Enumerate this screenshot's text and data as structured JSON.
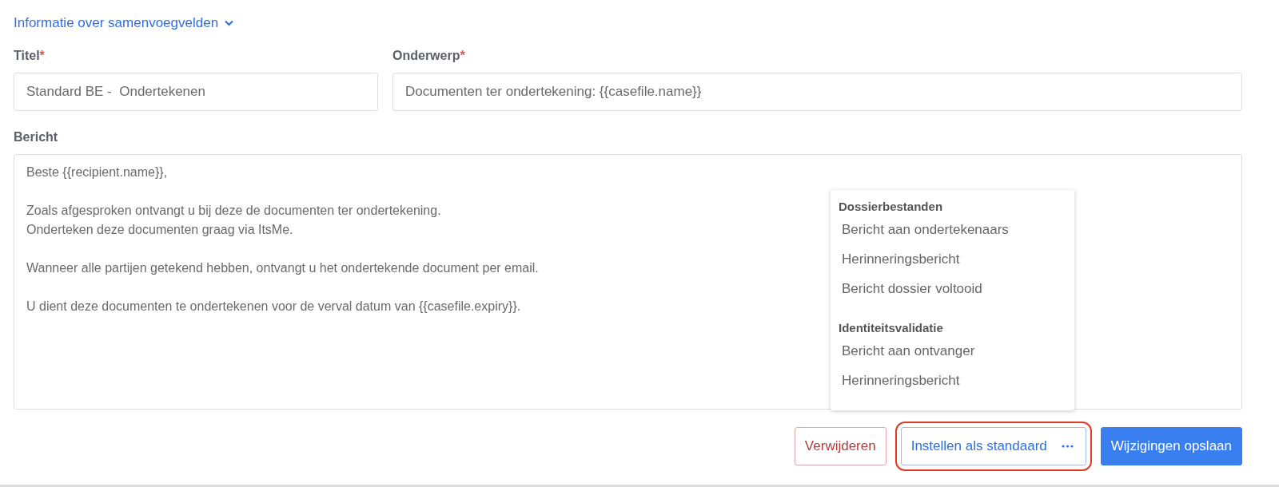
{
  "info_link": {
    "label": "Informatie over samenvoegvelden",
    "expanded": false
  },
  "fields": [
    {
      "label": "Titel",
      "required_mark": "*",
      "value": "Standard BE -  Ondertekenen"
    },
    {
      "label": "Onderwerp",
      "required_mark": "*",
      "value": "Documenten ter ondertekening: {{casefile.name}}"
    }
  ],
  "message": {
    "label": "Bericht",
    "paragraphs": [
      [
        "Beste {{recipient.name}},"
      ],
      [
        "Zoals afgesproken ontvangt u bij deze de documenten ter ondertekening.",
        "Onderteken deze documenten graag via ItsMe."
      ],
      [
        "Wanneer alle partijen getekend hebben, ontvangt u het ondertekende document per email."
      ],
      [
        "U dient deze documenten te ondertekenen voor de verval datum van {{casefile.expiry}}."
      ]
    ]
  },
  "menu": {
    "open": true,
    "groups": [
      {
        "heading": "Dossierbestanden",
        "items": [
          "Bericht aan ondertekenaars",
          "Herinneringsbericht",
          "Bericht dossier voltooid"
        ]
      },
      {
        "heading": "Identiteitsvalidatie",
        "items": [
          "Bericht aan ontvanger",
          "Herinneringsbericht"
        ]
      }
    ]
  },
  "buttons": [
    {
      "label": "Verwijderen",
      "kind": "danger",
      "highlighted": false
    },
    {
      "label": "Instellen als standaard",
      "kind": "menu",
      "highlighted": true
    },
    {
      "label": "Wijzigingen opslaan",
      "kind": "primary",
      "highlighted": false
    }
  ]
}
